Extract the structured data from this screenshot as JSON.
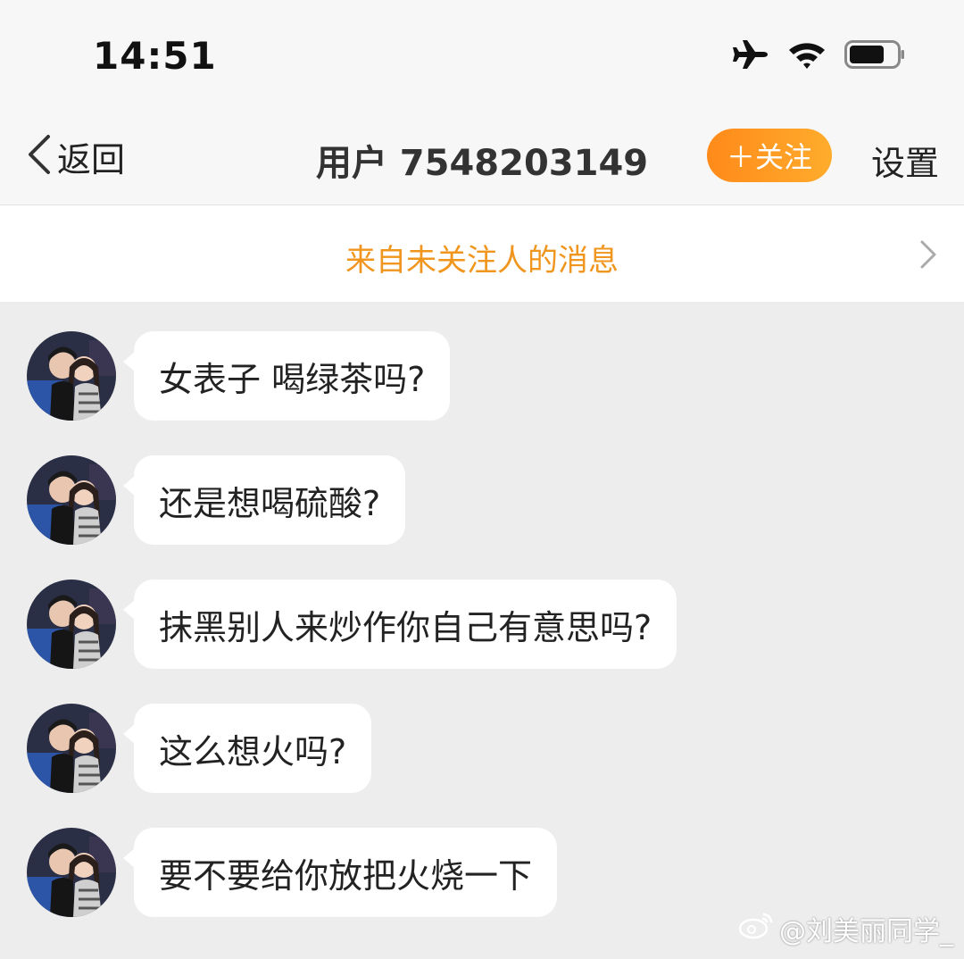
{
  "status_bar": {
    "time": "14:51",
    "icons": [
      "airplane-icon",
      "wifi-icon",
      "battery-icon"
    ]
  },
  "nav": {
    "back_label": "返回",
    "title": "用户 7548203149",
    "follow_label": "＋关注",
    "settings_label": "设置"
  },
  "notice": {
    "text": "来自未关注人的消息"
  },
  "messages": [
    {
      "text": "女表子 喝绿茶吗?"
    },
    {
      "text": "还是想喝硫酸?"
    },
    {
      "text": "抹黑别人来炒作你自己有意思吗?"
    },
    {
      "text": "这么想火吗?"
    },
    {
      "text": "要不要给你放把火烧一下"
    }
  ],
  "watermark": {
    "text": "@刘美丽同学_"
  },
  "colors": {
    "accent_orange": "#f0951d",
    "follow_gradient_start": "#ff8a1a",
    "follow_gradient_end": "#ffac2c",
    "chat_background": "#ededed",
    "bubble": "#ffffff"
  }
}
